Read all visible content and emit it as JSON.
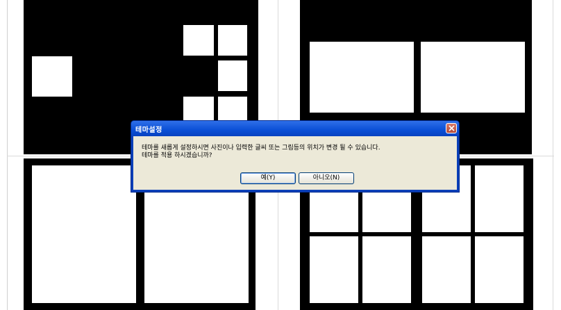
{
  "dialog": {
    "title": "테마설정",
    "message": "테마를 새롭게 설정하시면 사진이나 입력한 글씨 또는 그림등의 위치가 변경 될 수 있습니다.\n테마를 적용 하시겠습니까?",
    "yes_label": "예(Y)",
    "no_label": "아니오(N)"
  },
  "icons": {
    "close": "close-icon"
  },
  "colors": {
    "titlebar": "#0a4fd6",
    "dialog_body": "#ece9d8",
    "close_button": "#c45a48",
    "layout_fill": "#000000"
  }
}
